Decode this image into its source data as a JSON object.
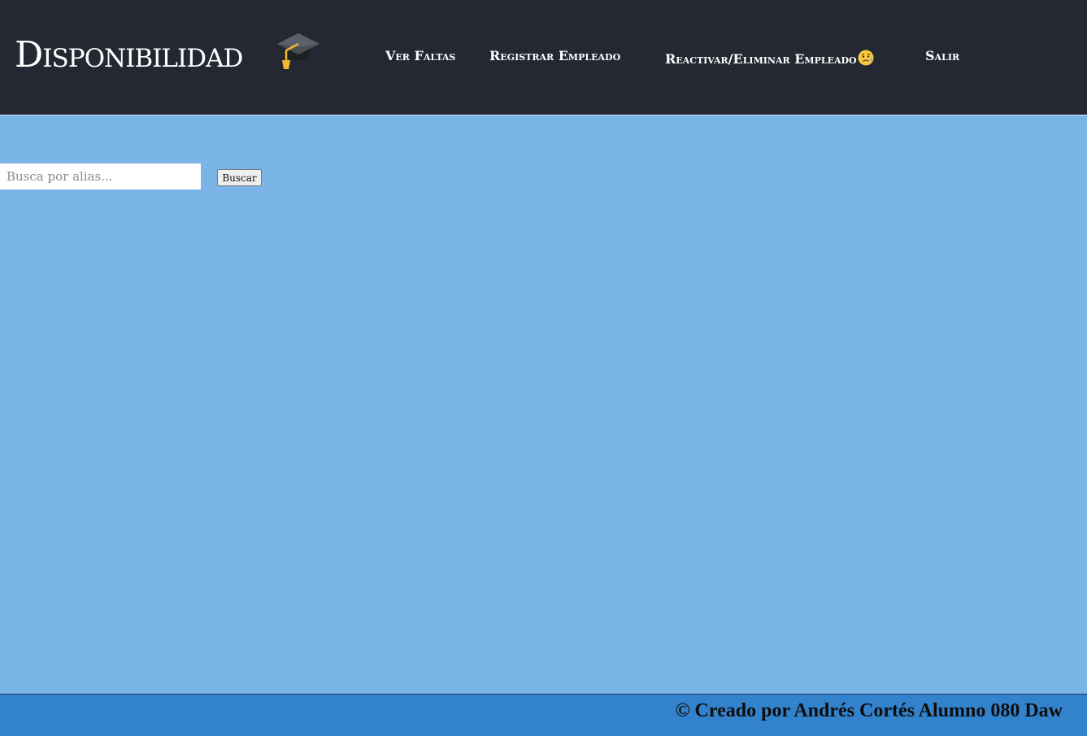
{
  "header": {
    "brand_title": "Disponibilidad",
    "nav": {
      "ver_faltas": "Ver Faltas",
      "registrar_empleado": "Registrar Empleado",
      "reactivar_eliminar": "Reactivar/Eliminar Empleado",
      "salir": "Salir"
    },
    "icons": {
      "brand_icon": "graduation-cap-icon",
      "nav_icon": "worried-face-icon"
    }
  },
  "search": {
    "placeholder": "Busca por alias...",
    "value": "",
    "button_label": "Buscar"
  },
  "footer": {
    "text": "© Creado por Andrés Cortés Alumno 080 Daw"
  },
  "colors": {
    "header_bg": "#242832",
    "page_bg": "#7bb5e8",
    "footer_bg": "#3282cc",
    "nav_text": "#ffffff"
  }
}
